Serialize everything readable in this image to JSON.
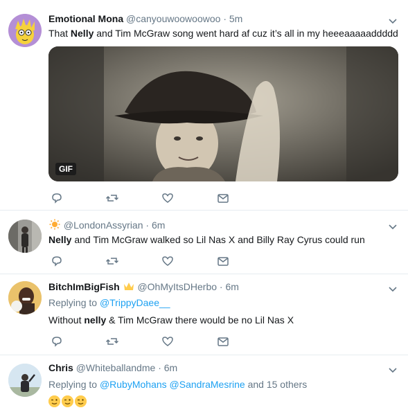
{
  "tweets": [
    {
      "name": "Emotional Mona",
      "handle": "@canyouwoowoowoo",
      "time": "5m",
      "text_pre": "That ",
      "text_bold": "Nelly",
      "text_post": " and Tim McGraw song went hard af cuz it’s all in my heeeaaaaaddddd",
      "media_badge": "GIF"
    },
    {
      "name_emoji": "sun-emoji-icon",
      "handle": "@LondonAssyrian",
      "time": "6m",
      "text_bold": "Nelly",
      "text_post": " and Tim McGraw walked so Lil Nas X and Billy Ray Cyrus could run"
    },
    {
      "name": "BitchImBigFish",
      "name_emoji": "crown-emoji-icon",
      "handle": "@OhMyItsDHerbo",
      "time": "6m",
      "replying_label": "Replying to ",
      "replying_to": "@TrippyDaee__",
      "text_pre": "Without ",
      "text_bold": "nelly",
      "text_post": " & Tim McGraw there would be no Lil Nas X"
    },
    {
      "name": "Chris",
      "handle": "@Whiteballandme",
      "time": "6m",
      "replying_label": "Replying to ",
      "replying_to_1": "@RubyMohans",
      "replying_to_2": "@SandraMesrine",
      "replying_others": " and 15 others",
      "emojis": [
        "wink-face-emoji-icon",
        "wink-face-emoji-icon",
        "wink-face-emoji-icon"
      ]
    }
  ],
  "separator": "·",
  "colors": {
    "link": "#1da1f2",
    "muted": "#657786",
    "divider": "#e6ecf0"
  },
  "actions": [
    "reply-icon",
    "retweet-icon",
    "like-icon",
    "message-icon"
  ]
}
